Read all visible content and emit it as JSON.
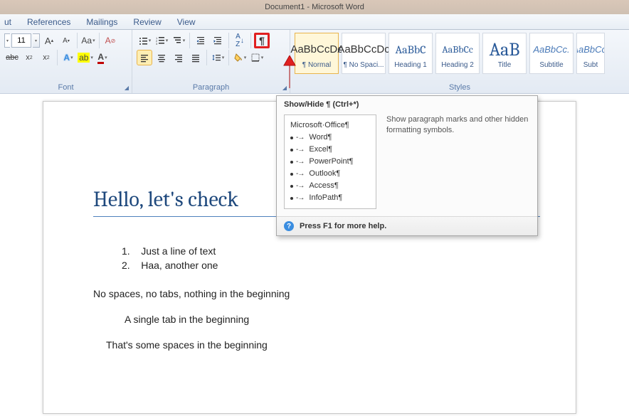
{
  "title": "Document1 - Microsoft Word",
  "tabs": [
    "ut",
    "References",
    "Mailings",
    "Review",
    "View"
  ],
  "font": {
    "size": "11",
    "group_label": "Font"
  },
  "paragraph": {
    "group_label": "Paragraph"
  },
  "styles": {
    "group_label": "Styles",
    "items": [
      {
        "sample": "AaBbCcDc",
        "name": "¶ Normal",
        "cls": ""
      },
      {
        "sample": "AaBbCcDc",
        "name": "¶ No Spaci...",
        "cls": ""
      },
      {
        "sample": "AaBbC",
        "name": "Heading 1",
        "cls": "blue"
      },
      {
        "sample": "AaBbCc",
        "name": "Heading 2",
        "cls": "blue"
      },
      {
        "sample": "AaB",
        "name": "Title",
        "cls": "big"
      },
      {
        "sample": "AaBbCc.",
        "name": "Subtitle",
        "cls": "ital"
      },
      {
        "sample": "AaBbCc.",
        "name": "Subt",
        "cls": "ital"
      }
    ]
  },
  "tooltip": {
    "title": "Show/Hide ¶ (Ctrl+*)",
    "desc": "Show paragraph marks and other hidden formatting symbols.",
    "footer": "Press F1 for more help.",
    "preview_header": "Microsoft·Office¶",
    "preview_items": [
      "Word¶",
      "Excel¶",
      "PowerPoint¶",
      "Outlook¶",
      "Access¶",
      "InfoPath¶"
    ]
  },
  "document": {
    "heading": "Hello, let's check",
    "list": [
      "Just a line of text",
      "Haa, another one"
    ],
    "p1": "No spaces, no tabs, nothing in the beginning",
    "p2": "A single tab in the beginning",
    "p3": "That's some spaces in the beginning"
  }
}
